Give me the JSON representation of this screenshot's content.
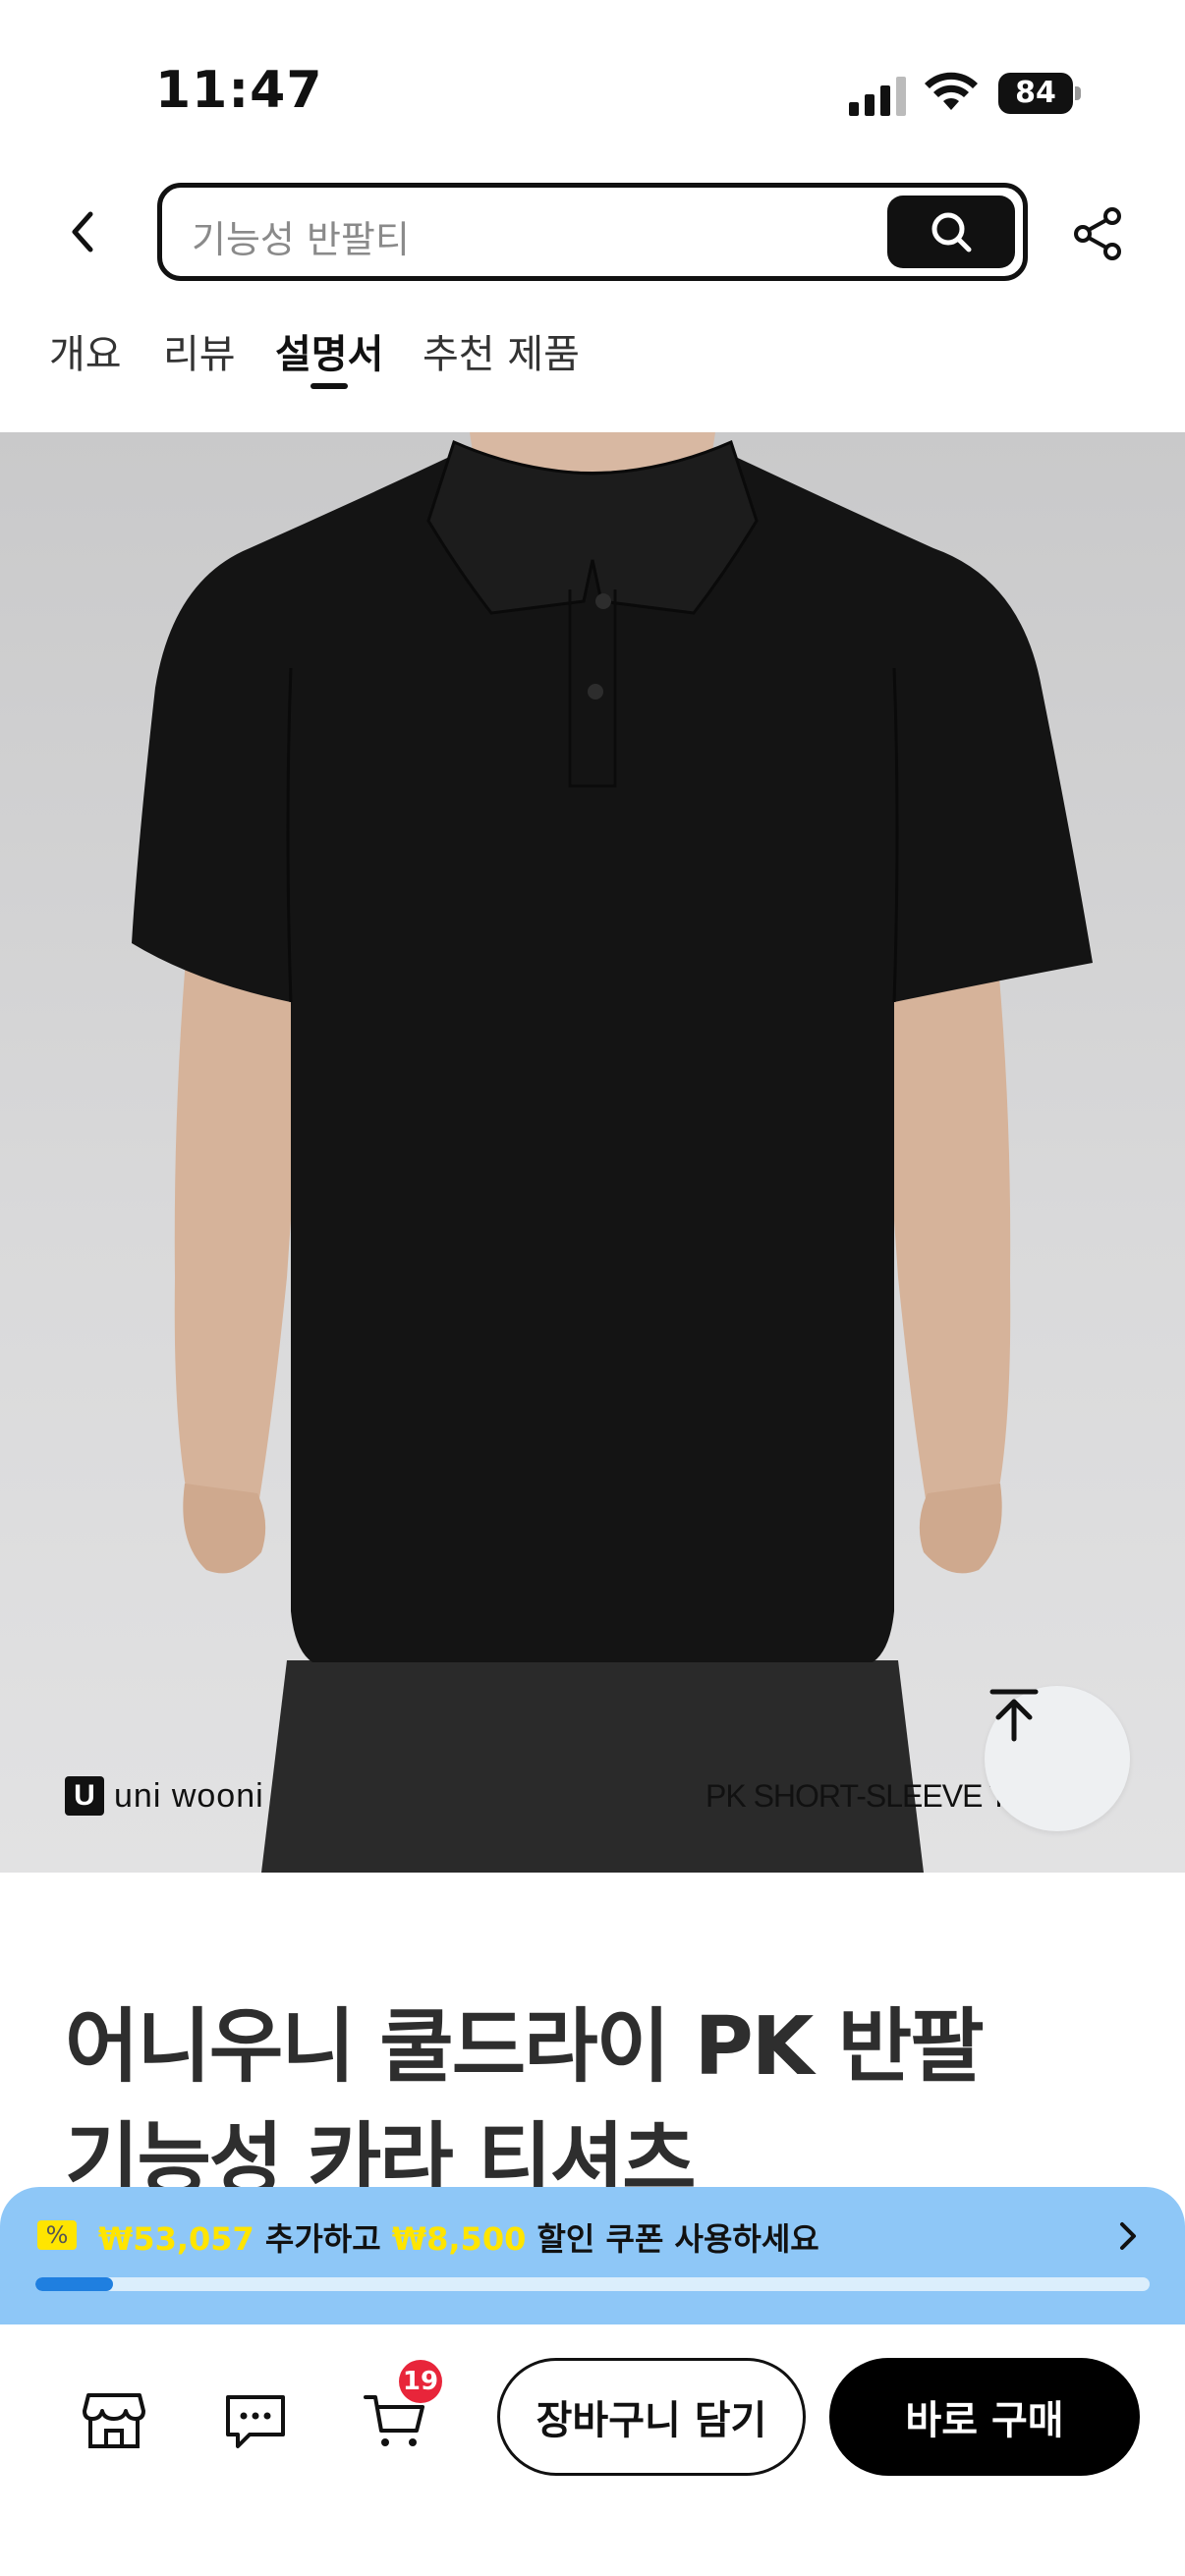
{
  "status_bar": {
    "time": "11:47",
    "battery": "84",
    "icons": [
      "cellular-signal-icon",
      "wifi-icon",
      "battery-icon"
    ]
  },
  "header": {
    "search_placeholder": "기능성 반팔티",
    "icons": [
      "back-arrow-icon",
      "search-icon",
      "share-icon"
    ]
  },
  "tabs": [
    {
      "label": "개요",
      "active": false
    },
    {
      "label": "리뷰",
      "active": false
    },
    {
      "label": "설명서",
      "active": true
    },
    {
      "label": "추천 제품",
      "active": false
    }
  ],
  "product_image": {
    "brand_mark": "U",
    "brand_name": "uni wooni",
    "caption": "PK SHORT-SLEEVE T"
  },
  "product": {
    "title_line1": "어니우니 쿨드라이 PK 반팔",
    "title_line2": "기능성 카라 티셔츠"
  },
  "coupon_banner": {
    "badge": "%",
    "amount_needed": "₩53,057",
    "text_middle": " 추가하고 ",
    "discount": "₩8,500",
    "text_end": " 할인 쿠폰 사용하세요",
    "progress": 0.07,
    "colors": {
      "background": "#8ec7f7",
      "accent": "#ffe500",
      "progress": "#1f7fe0"
    }
  },
  "bottom_bar": {
    "cart_count": "19",
    "add_to_cart_label": "장바구니 담기",
    "buy_now_label": "바로 구매",
    "icons": [
      "store-icon",
      "chat-icon",
      "cart-icon"
    ]
  }
}
